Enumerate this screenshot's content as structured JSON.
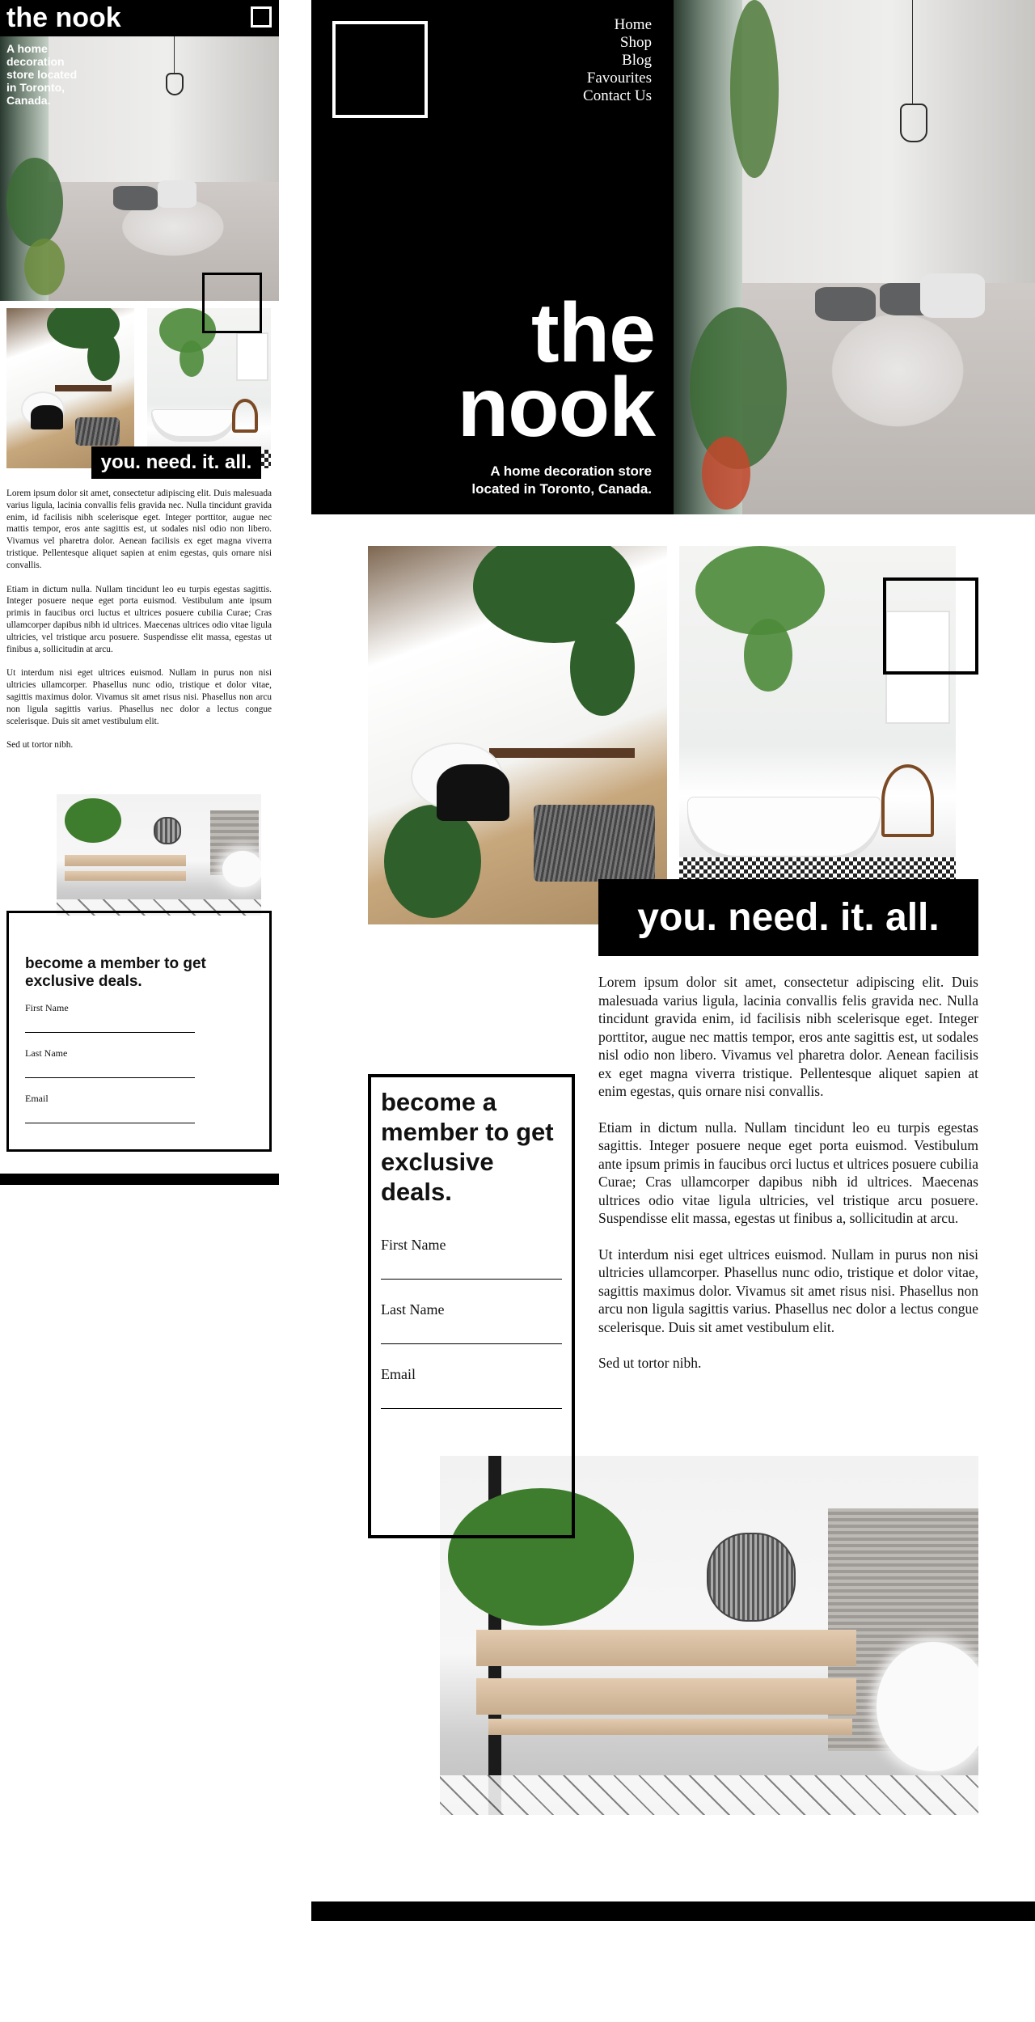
{
  "brand": {
    "name": "the nook",
    "name_line1": "the",
    "name_line2": "nook",
    "tagline_mobile": "A home decoration store located in Toronto, Canada.",
    "tagline_desktop_line1": "A home decoration store",
    "tagline_desktop_line2": "located in Toronto, Canada."
  },
  "nav": {
    "items": [
      {
        "label": "Home"
      },
      {
        "label": "Shop"
      },
      {
        "label": "Blog"
      },
      {
        "label": "Favourites"
      },
      {
        "label": "Contact Us"
      }
    ]
  },
  "promo": {
    "headline": "you. need. it. all."
  },
  "article": {
    "paragraphs": [
      "Lorem ipsum dolor sit amet, consectetur adipiscing elit. Duis malesuada varius ligula, lacinia convallis felis gravida nec. Nulla tincidunt gravida enim, id facilisis nibh scelerisque eget. Integer porttitor, augue nec mattis tempor, eros ante sagittis est, ut sodales nisl odio non libero. Vivamus vel pharetra dolor. Aenean facilisis ex eget magna viverra tristique. Pellentesque aliquet sapien at enim egestas, quis ornare nisi convallis.",
      "Etiam in dictum nulla. Nullam tincidunt leo eu turpis egestas sagittis. Integer posuere neque eget porta euismod. Vestibulum ante ipsum primis in faucibus orci luctus et ultrices posuere cubilia Curae; Cras ullamcorper dapibus nibh id ultrices. Maecenas ultrices odio vitae ligula ultricies, vel tristique arcu posuere. Suspendisse elit massa, egestas ut finibus a, sollicitudin at arcu.",
      "Ut interdum nisi eget ultrices euismod. Nullam in purus non nisi ultricies ullamcorper. Phasellus nunc odio, tristique et dolor vitae, sagittis maximus dolor. Vivamus sit amet risus nisi. Phasellus non arcu non ligula sagittis varius. Phasellus nec dolor a lectus congue scelerisque. Duis sit amet vestibulum elit.",
      "Sed ut tortor nibh."
    ]
  },
  "membership": {
    "title": "become a member to get exclusive deals.",
    "fields": [
      {
        "label": "First Name",
        "value": ""
      },
      {
        "label": "Last Name",
        "value": ""
      },
      {
        "label": "Email",
        "value": ""
      }
    ]
  },
  "images": {
    "hero": "bedroom-photo",
    "study": "study-nook-photo",
    "bath": "bathroom-photo",
    "pallet": "pallet-table-photo"
  },
  "colors": {
    "background": "#ffffff",
    "ink": "#000000",
    "inverse": "#ffffff"
  }
}
